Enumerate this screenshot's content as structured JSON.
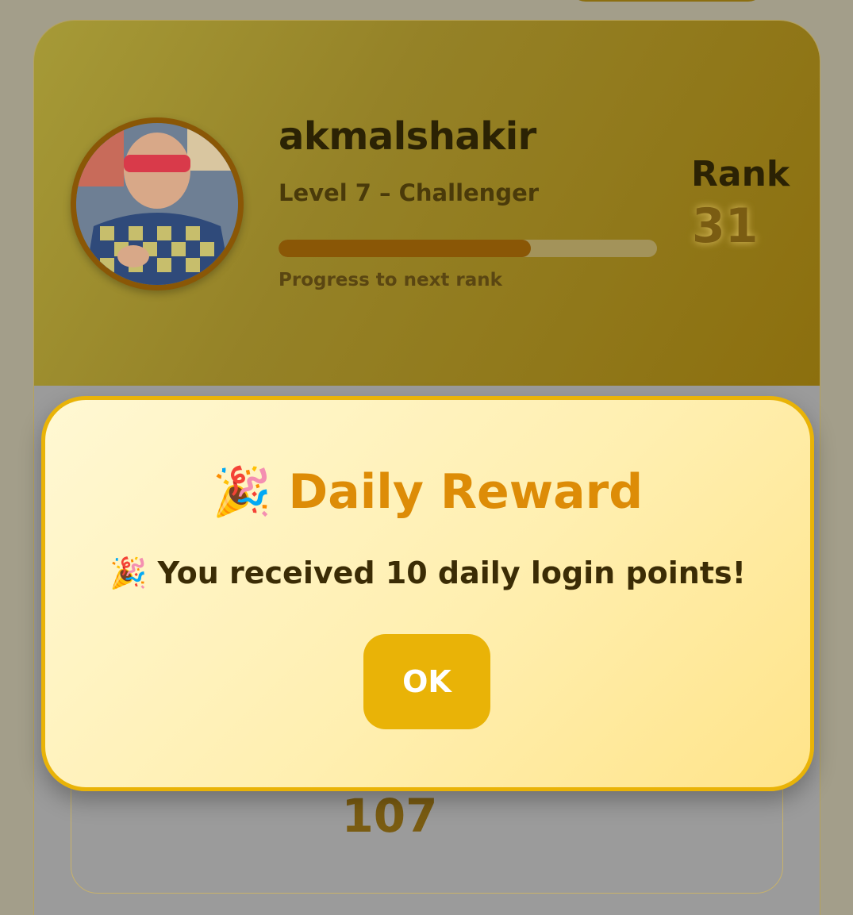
{
  "profile": {
    "username": "akmalshakir",
    "level_text": "Level 7 – Challenger",
    "progress": 0.667,
    "progress_label": "Progress to next rank",
    "rank_label": "Rank",
    "rank_value": "31"
  },
  "points": {
    "value": "107"
  },
  "modal": {
    "title_emoji": "🎉",
    "title": "Daily Reward",
    "message_emoji": "🎉",
    "message": "You received 10 daily login points!",
    "ok_label": "OK"
  },
  "colors": {
    "accent": "#e9b307",
    "title": "#dd8c07",
    "header_dark": "#8c6f0e",
    "progress_fill": "#8a5706"
  }
}
